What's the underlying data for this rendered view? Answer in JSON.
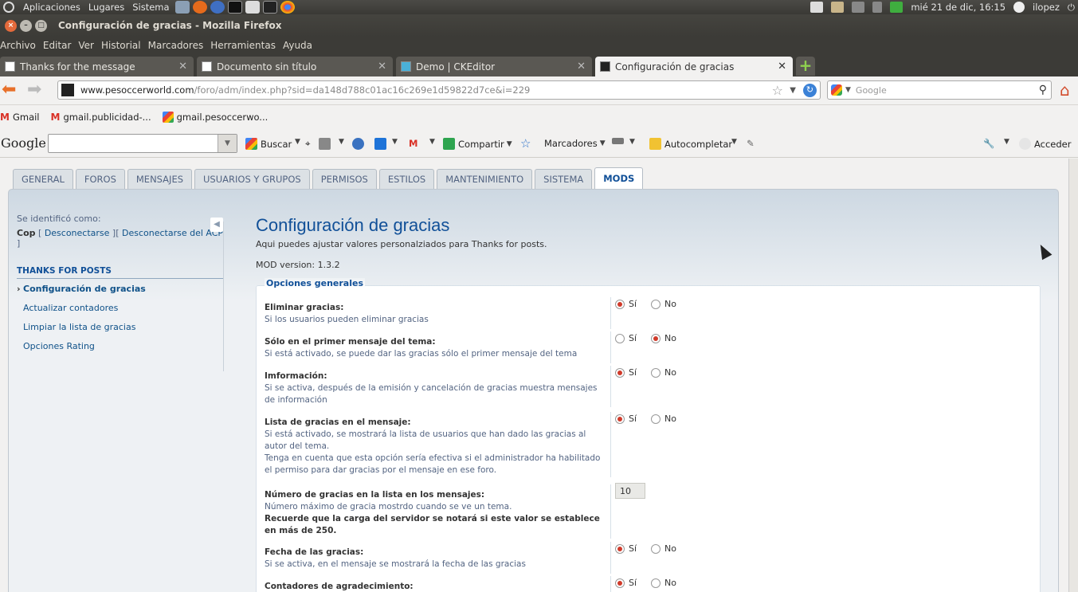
{
  "top_panel": {
    "menus": [
      "Aplicaciones",
      "Lugares",
      "Sistema"
    ],
    "clock": "mié 21 de dic, 16:15",
    "user": "ilopez"
  },
  "window": {
    "title": "Configuración de gracias - Mozilla Firefox"
  },
  "menubar": [
    "Archivo",
    "Editar",
    "Ver",
    "Historial",
    "Marcadores",
    "Herramientas",
    "Ayuda"
  ],
  "tabs": [
    {
      "label": "Thanks for the message"
    },
    {
      "label": "Documento sin título"
    },
    {
      "label": "Demo | CKEditor"
    },
    {
      "label": "Configuración de gracias"
    }
  ],
  "url": {
    "domain": "www.pesoccerworld.com",
    "path": "/foro/adm/index.php?sid=da148d788c01ac16c269e1d59822d7ce&i=229"
  },
  "search": {
    "placeholder": "Google"
  },
  "bookmarks": [
    "Gmail",
    "gmail.publicidad-...",
    "gmail.pesoccerwo..."
  ],
  "google_toolbar": {
    "logo": "Google",
    "buscar": "Buscar",
    "compartir": "Compartir",
    "marcadores": "Marcadores",
    "autocompletar": "Autocompletar",
    "acceder": "Acceder"
  },
  "acp_tabs": [
    "GENERAL",
    "FOROS",
    "MENSAJES",
    "USUARIOS Y GRUPOS",
    "PERMISOS",
    "ESTILOS",
    "MANTENIMIENTO",
    "SISTEMA",
    "MODS"
  ],
  "sidebar": {
    "login_label": "Se identificó como:",
    "user": "Cop",
    "logout": "Desconectarse",
    "logout_acp": "Desconectarse del ACP",
    "section": "THANKS FOR POSTS",
    "items": [
      {
        "label": "Configuración de gracias"
      },
      {
        "label": "Actualizar contadores"
      },
      {
        "label": "Limpiar la lista de gracias"
      },
      {
        "label": "Opciones Rating"
      }
    ]
  },
  "main": {
    "title": "Configuración de gracias",
    "intro": "Aqui puedes ajustar valores personalziados para Thanks for posts.",
    "mod_version": "MOD version: 1.3.2",
    "legend": "Opciones generales",
    "yes": "Sí",
    "no": "No",
    "options": [
      {
        "title": "Eliminar gracias:",
        "desc": "Si los usuarios pueden eliminar gracias",
        "value": "yes"
      },
      {
        "title": "Sólo en el primer mensaje del tema:",
        "desc": "Si está activado, se puede dar las gracias sólo el primer mensaje del tema",
        "value": "no"
      },
      {
        "title": "Imformación:",
        "desc": "Si se activa, después de la emisión y cancelación de gracias muestra mensajes de información",
        "value": "yes"
      },
      {
        "title": "Lista de gracias en el mensaje:",
        "desc": "Si está activado, se mostrará la lista de usuarios que han dado las gracias al autor del tema.",
        "desc2": "Tenga en cuenta que esta opción sería efectiva si el administrador ha habilitado el permiso para dar gracias por el mensaje en ese foro.",
        "value": "yes"
      },
      {
        "title": "Número de gracias en la lista en los mensajes:",
        "desc": "Número máximo de gracia mostrdo cuando se ve un tema.",
        "warn": "Recuerde que la carga del servidor se notará si este valor se establece en más de 250.",
        "number": "10"
      },
      {
        "title": "Fecha de las gracias:",
        "desc": "Si se activa, en el mensaje se mostrará la fecha de las gracias",
        "value": "yes"
      },
      {
        "title": "Contadores de agradecimiento:",
        "desc": "",
        "value": "yes"
      }
    ]
  }
}
